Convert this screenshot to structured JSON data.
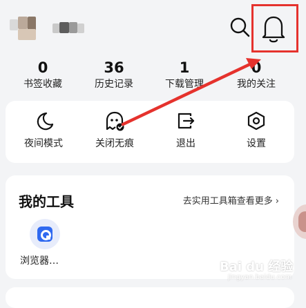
{
  "header": {
    "search_icon": "search-icon",
    "notification_icon": "bell-icon"
  },
  "stats": [
    {
      "value": "0",
      "label": "书签收藏"
    },
    {
      "value": "36",
      "label": "历史记录"
    },
    {
      "value": "1",
      "label": "下载管理"
    },
    {
      "value": "0",
      "label": "我的关注"
    }
  ],
  "quick_actions": [
    {
      "label": "夜间模式",
      "icon": "moon-icon"
    },
    {
      "label": "关闭无痕",
      "icon": "ghost-icon"
    },
    {
      "label": "退出",
      "icon": "exit-icon"
    },
    {
      "label": "设置",
      "icon": "hexagon-settings-icon"
    }
  ],
  "tools": {
    "title": "我的工具",
    "more_link": "去实用工具箱查看更多",
    "items": [
      {
        "label": "浏览器…",
        "icon": "browser-tool-icon"
      }
    ]
  },
  "watermark": {
    "text": "Bai du 经验",
    "url": "jingyan.baidu.com"
  },
  "colors": {
    "annotation_red": "#e5322d",
    "accent_blue": "#2f69f0",
    "background": "#f3f4f6"
  }
}
